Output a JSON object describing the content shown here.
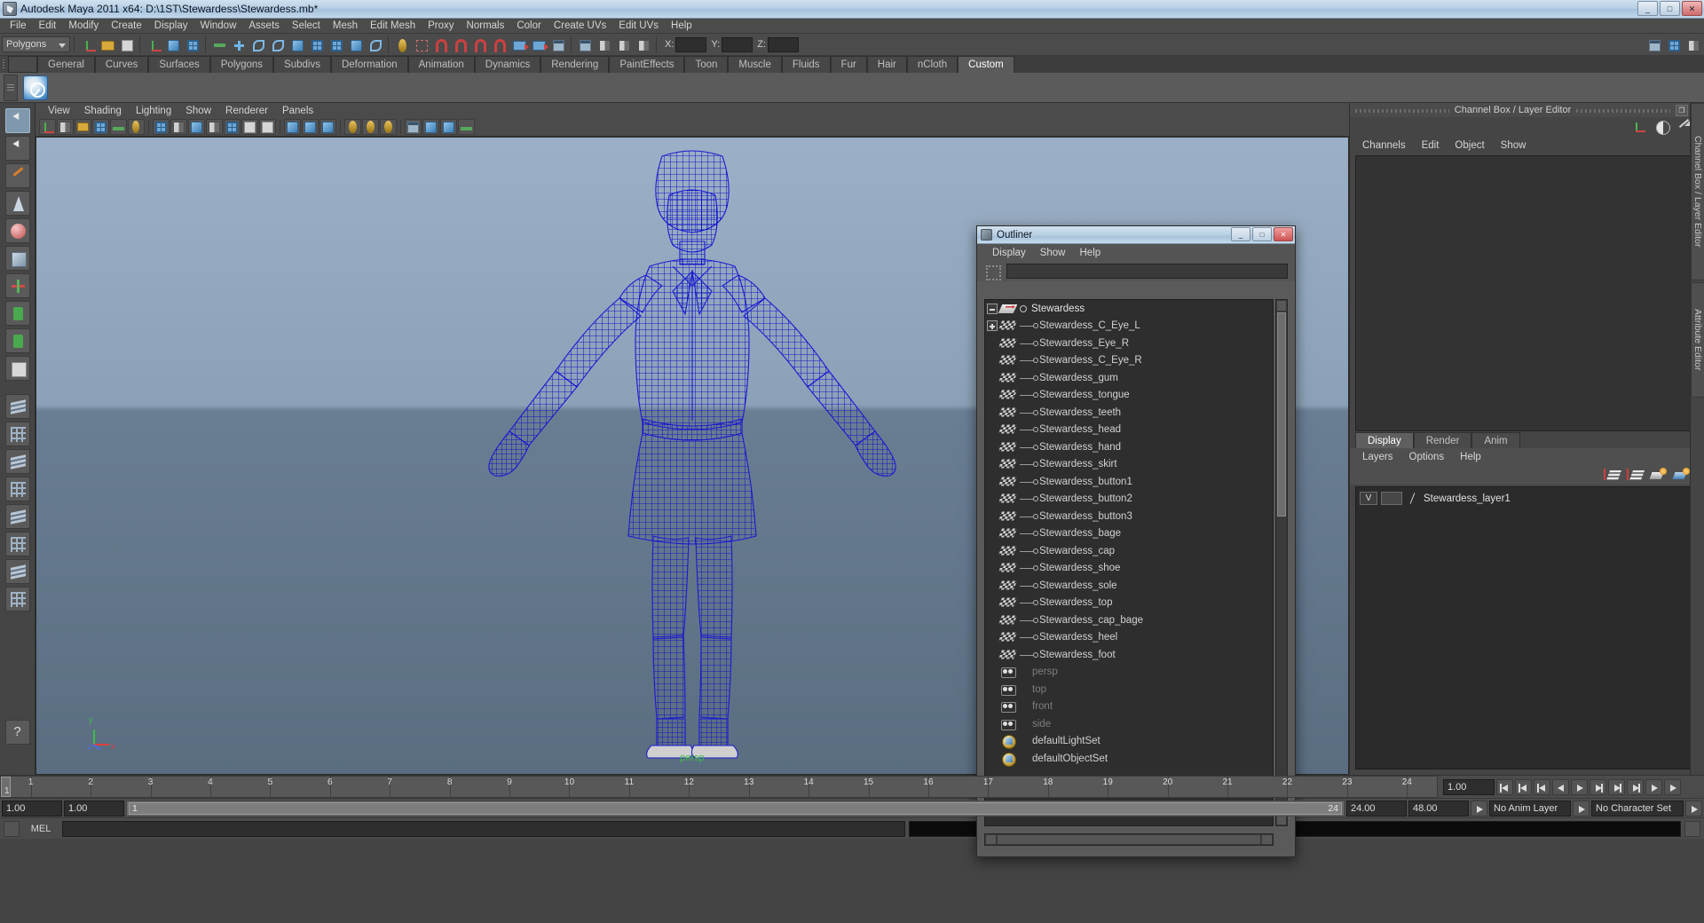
{
  "window": {
    "title": "Autodesk Maya 2011 x64: D:\\1ST\\Stewardess\\Stewardess.mb*",
    "app_icon": "maya-icon",
    "minimize": "_",
    "maximize": "□",
    "close": "✕"
  },
  "menubar": {
    "items": [
      "File",
      "Edit",
      "Modify",
      "Create",
      "Display",
      "Window",
      "Assets",
      "Select",
      "Mesh",
      "Edit Mesh",
      "Proxy",
      "Normals",
      "Color",
      "Create UVs",
      "Edit UVs",
      "Help"
    ]
  },
  "toolbar": {
    "menu_set": "Polygons",
    "axis_labels": [
      "X:",
      "Y:",
      "Z:"
    ],
    "axis_values": [
      "",
      "",
      ""
    ]
  },
  "shelf": {
    "tabs": [
      "General",
      "Curves",
      "Surfaces",
      "Polygons",
      "Subdivs",
      "Deformation",
      "Animation",
      "Dynamics",
      "Rendering",
      "PaintEffects",
      "Toon",
      "Muscle",
      "Fluids",
      "Fur",
      "Hair",
      "nCloth",
      "Custom"
    ],
    "active_tab": "Custom",
    "buttons": [
      "check-sphere-icon"
    ]
  },
  "viewport": {
    "menus": [
      "View",
      "Shading",
      "Lighting",
      "Show",
      "Renderer",
      "Panels"
    ],
    "camera_label": "persp",
    "axis_x": "x",
    "axis_y": "y",
    "axis_z": "z",
    "model_color": "#1a1ad0",
    "bg_top": "#9bb0c6",
    "bg_bottom": "#5a6d81"
  },
  "outliner": {
    "title": "Outliner",
    "menus": [
      "Display",
      "Show",
      "Help"
    ],
    "search_value": "",
    "min_label": "_",
    "max_label": "□",
    "close_label": "✕",
    "items": [
      {
        "name": "Stewardess",
        "icon": "group-root-icon",
        "kind": "root",
        "indent": 0,
        "expander": "minus"
      },
      {
        "name": "Stewardess_C_Eye_L",
        "icon": "mesh-icon",
        "kind": "mesh",
        "indent": 1,
        "expander": "plus"
      },
      {
        "name": "Stewardess_Eye_R",
        "icon": "mesh-icon",
        "kind": "mesh",
        "indent": 1,
        "expander": "none"
      },
      {
        "name": "Stewardess_C_Eye_R",
        "icon": "mesh-icon",
        "kind": "mesh",
        "indent": 1,
        "expander": "none"
      },
      {
        "name": "Stewardess_gum",
        "icon": "mesh-icon",
        "kind": "mesh",
        "indent": 1,
        "expander": "none"
      },
      {
        "name": "Stewardess_tongue",
        "icon": "mesh-icon",
        "kind": "mesh",
        "indent": 1,
        "expander": "none"
      },
      {
        "name": "Stewardess_teeth",
        "icon": "mesh-icon",
        "kind": "mesh",
        "indent": 1,
        "expander": "none"
      },
      {
        "name": "Stewardess_head",
        "icon": "mesh-icon",
        "kind": "mesh",
        "indent": 1,
        "expander": "none"
      },
      {
        "name": "Stewardess_hand",
        "icon": "mesh-icon",
        "kind": "mesh",
        "indent": 1,
        "expander": "none"
      },
      {
        "name": "Stewardess_skirt",
        "icon": "mesh-icon",
        "kind": "mesh",
        "indent": 1,
        "expander": "none"
      },
      {
        "name": "Stewardess_button1",
        "icon": "mesh-icon",
        "kind": "mesh",
        "indent": 1,
        "expander": "none"
      },
      {
        "name": "Stewardess_button2",
        "icon": "mesh-icon",
        "kind": "mesh",
        "indent": 1,
        "expander": "none"
      },
      {
        "name": "Stewardess_button3",
        "icon": "mesh-icon",
        "kind": "mesh",
        "indent": 1,
        "expander": "none"
      },
      {
        "name": "Stewardess_bage",
        "icon": "mesh-icon",
        "kind": "mesh",
        "indent": 1,
        "expander": "none"
      },
      {
        "name": "Stewardess_cap",
        "icon": "mesh-icon",
        "kind": "mesh",
        "indent": 1,
        "expander": "none"
      },
      {
        "name": "Stewardess_shoe",
        "icon": "mesh-icon",
        "kind": "mesh",
        "indent": 1,
        "expander": "none"
      },
      {
        "name": "Stewardess_sole",
        "icon": "mesh-icon",
        "kind": "mesh",
        "indent": 1,
        "expander": "none"
      },
      {
        "name": "Stewardess_top",
        "icon": "mesh-icon",
        "kind": "mesh",
        "indent": 1,
        "expander": "none"
      },
      {
        "name": "Stewardess_cap_bage",
        "icon": "mesh-icon",
        "kind": "mesh",
        "indent": 1,
        "expander": "none"
      },
      {
        "name": "Stewardess_heel",
        "icon": "mesh-icon",
        "kind": "mesh",
        "indent": 1,
        "expander": "none"
      },
      {
        "name": "Stewardess_foot",
        "icon": "mesh-icon",
        "kind": "mesh",
        "indent": 1,
        "expander": "none"
      },
      {
        "name": "persp",
        "icon": "camera-icon",
        "kind": "camera",
        "indent": 0,
        "expander": "none"
      },
      {
        "name": "top",
        "icon": "camera-icon",
        "kind": "camera",
        "indent": 0,
        "expander": "none"
      },
      {
        "name": "front",
        "icon": "camera-icon",
        "kind": "camera",
        "indent": 0,
        "expander": "none"
      },
      {
        "name": "side",
        "icon": "camera-icon",
        "kind": "camera",
        "indent": 0,
        "expander": "none"
      },
      {
        "name": "defaultLightSet",
        "icon": "set-icon",
        "kind": "set",
        "indent": 0,
        "expander": "none"
      },
      {
        "name": "defaultObjectSet",
        "icon": "set-icon",
        "kind": "set",
        "indent": 0,
        "expander": "none"
      }
    ]
  },
  "channel_box": {
    "panel_title": "Channel Box / Layer Editor",
    "restore_label": "❐",
    "close_label": "✕",
    "menus": [
      "Channels",
      "Edit",
      "Object",
      "Show"
    ],
    "side_tabs": [
      "Channel Box / Layer Editor",
      "Attribute Editor"
    ]
  },
  "layer_editor": {
    "tabs": [
      "Display",
      "Render",
      "Anim"
    ],
    "active_tab": "Display",
    "menus": [
      "Layers",
      "Options",
      "Help"
    ],
    "toolbar_icons": [
      "move-layer-up-icon",
      "move-layer-down-icon",
      "new-layer-icon",
      "new-layer-from-selected-icon"
    ],
    "layers": [
      {
        "visibility": "V",
        "display_type": "",
        "shade": "",
        "name": "Stewardess_layer1"
      }
    ]
  },
  "timeline": {
    "frames": [
      "1",
      "2",
      "3",
      "4",
      "5",
      "6",
      "7",
      "8",
      "9",
      "10",
      "11",
      "12",
      "13",
      "14",
      "15",
      "16",
      "17",
      "18",
      "19",
      "20",
      "21",
      "22",
      "23",
      "24"
    ],
    "current_frame_small": "1",
    "current_frame": "1.00",
    "playback_start": "1.00",
    "range_start": "1.00",
    "range_slider_left": "1",
    "range_slider_right": "24",
    "range_end": "24.00",
    "playback_end": "48.00",
    "anim_layer": "No Anim Layer",
    "character_set": "No Character Set",
    "transport_buttons": [
      "go-to-start-icon",
      "step-back-key-icon",
      "step-back-frame-icon",
      "play-backwards-icon",
      "play-forwards-icon",
      "step-forward-frame-icon",
      "step-forward-key-icon",
      "go-to-end-icon"
    ]
  },
  "command_line": {
    "label": "MEL",
    "command_value": "",
    "output_value": ""
  }
}
